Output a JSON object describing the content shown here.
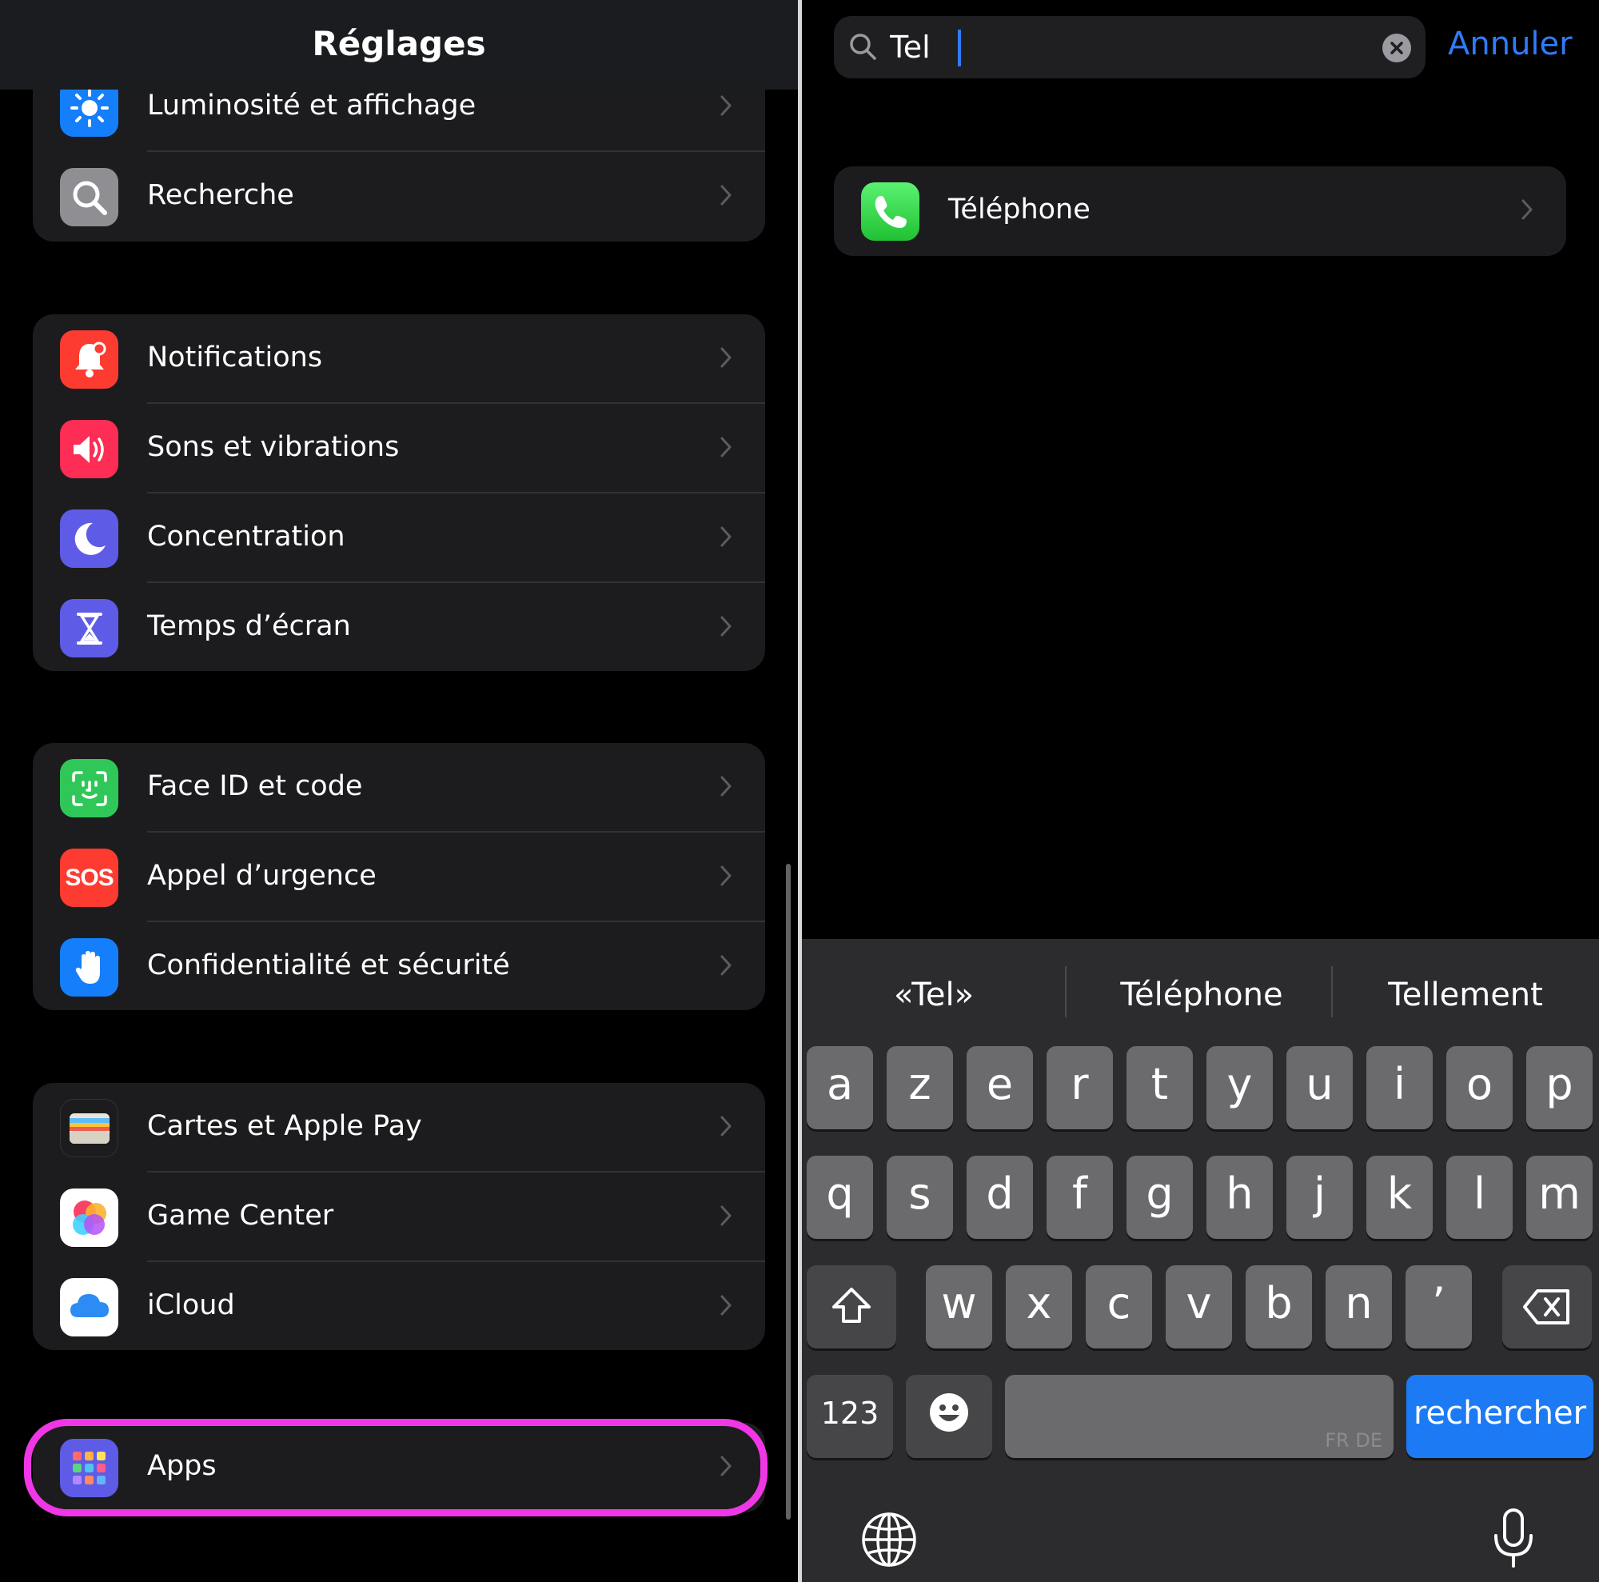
{
  "settings": {
    "title": "Réglages",
    "items": [
      {
        "label": "Luminosité et affichage",
        "icon": "sun-icon",
        "color": "#157efb"
      },
      {
        "label": "Recherche",
        "icon": "magnifier-icon",
        "color": "#8e8e93"
      },
      {
        "label": "Notifications",
        "icon": "bell-icon",
        "color": "#fd3b30"
      },
      {
        "label": "Sons et vibrations",
        "icon": "speaker-icon",
        "color": "#fd2d55"
      },
      {
        "label": "Concentration",
        "icon": "moon-icon",
        "color": "#5e5ce6"
      },
      {
        "label": "Temps d’écran",
        "icon": "hourglass-icon",
        "color": "#5e5ce6"
      },
      {
        "label": "Face ID et code",
        "icon": "faceid-icon",
        "color": "#30c759"
      },
      {
        "label": "Appel d’urgence",
        "icon": "sos-icon",
        "color": "#fd3b30",
        "icon_text": "SOS"
      },
      {
        "label": "Confidentialité et sécurité",
        "icon": "hand-icon",
        "color": "#157efb"
      },
      {
        "label": "Cartes et Apple Pay",
        "icon": "wallet-icon",
        "color": "#1c1c1e"
      },
      {
        "label": "Game Center",
        "icon": "game-center-icon",
        "color": "#ffffff"
      },
      {
        "label": "iCloud",
        "icon": "cloud-icon",
        "color": "#ffffff"
      },
      {
        "label": "Apps",
        "icon": "apps-grid-icon",
        "color": "#5e5ce6"
      }
    ],
    "highlight_color": "#f037e6"
  },
  "search": {
    "query": "Tel",
    "cancel_label": "Annuler",
    "results": [
      {
        "label": "Téléphone",
        "icon": "phone-icon",
        "color": "#30c759"
      }
    ]
  },
  "keyboard": {
    "suggestions": [
      "«Tel»",
      "Téléphone",
      "Tellement"
    ],
    "row1": [
      "a",
      "z",
      "e",
      "r",
      "t",
      "y",
      "u",
      "i",
      "o",
      "p"
    ],
    "row2": [
      "q",
      "s",
      "d",
      "f",
      "g",
      "h",
      "j",
      "k",
      "l",
      "m"
    ],
    "row3": [
      "w",
      "x",
      "c",
      "v",
      "b",
      "n",
      "’"
    ],
    "numbers_label": "123",
    "space_tag": "FR DE",
    "return_label": "rechercher",
    "accent_color": "#1d7af5"
  }
}
